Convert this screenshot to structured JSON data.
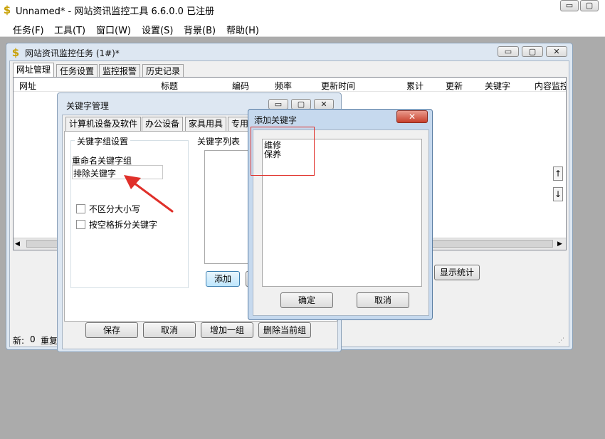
{
  "app": {
    "title": "Unnamed* - 网站资讯监控工具 6.6.0.0  已注册",
    "icon": "dollar-icon",
    "caption_buttons": {
      "minimize": "▭",
      "maximize": "▢"
    }
  },
  "menu": [
    "任务(F)",
    "工具(T)",
    "窗口(W)",
    "设置(S)",
    "背景(B)",
    "帮助(H)"
  ],
  "task_window": {
    "title": "网站资讯监控任务  (1#)*",
    "tabs": [
      "网址管理",
      "任务设置",
      "监控报警",
      "历史记录"
    ],
    "columns": [
      "网址",
      "标题",
      "编码",
      "频率",
      "更新时间",
      "累计",
      "更新",
      "关键字",
      "内容监控"
    ],
    "up_arrow": "↑",
    "down_arrow": "↓",
    "stats_button": "显示统计",
    "status_new_label": "新:",
    "status_new_value": "0",
    "status_repeat_label": "重复"
  },
  "keyword_manager": {
    "title": "关键字管理",
    "tabs": [
      "计算机设备及软件",
      "办公设备",
      "家具用具",
      "专用"
    ],
    "group_settings_title": "关键字组设置",
    "rename_label": "重命名关键字组",
    "rename_value": "排除关键字",
    "case_insensitive_label": "不区分大小写",
    "split_by_space_label": "按空格拆分关键字",
    "keyword_list_title": "关键字列表",
    "add_button": "添加",
    "save_button": "保存",
    "cancel_button": "取消",
    "add_group_button": "增加一组",
    "delete_group_button": "删除当前组"
  },
  "add_keyword_dialog": {
    "title": "添加关键字",
    "keywords": [
      "维修",
      "保养"
    ],
    "ok_button": "确定",
    "cancel_button": "取消",
    "close_glyph": "✕"
  },
  "annotation_color": "#e0302a"
}
